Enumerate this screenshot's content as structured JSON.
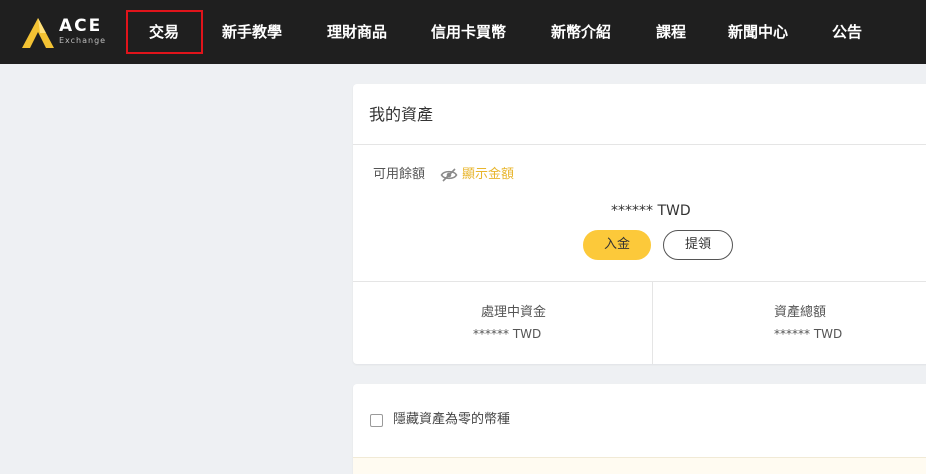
{
  "brand": {
    "name": "ACE",
    "sub": "Exchange"
  },
  "nav": {
    "items": [
      {
        "label": "交易",
        "active": true
      },
      {
        "label": "新手教學"
      },
      {
        "label": "理財商品"
      },
      {
        "label": "信用卡買幣"
      },
      {
        "label": "新幣介紹"
      },
      {
        "label": "課程"
      },
      {
        "label": "新聞中心"
      },
      {
        "label": "公告"
      }
    ]
  },
  "assets": {
    "title": "我的資產",
    "available_label": "可用餘額",
    "show_amount": "顯示金額",
    "balance": "******  TWD",
    "deposit_label": "入金",
    "withdraw_label": "提領",
    "processing_label": "處理中資金",
    "processing_value": "****** TWD",
    "total_label": "資產總額",
    "total_value": "****** TWD"
  },
  "options": {
    "hide_zero_label": "隱藏資產為零的幣種"
  },
  "colors": {
    "accent": "#fcc93a",
    "link": "#e8b52c",
    "nav_bg": "#1f1f1f",
    "active_border": "#e0141b"
  },
  "icons": {
    "visibility": "eye-off-icon",
    "logo": "ace-logo-icon"
  }
}
